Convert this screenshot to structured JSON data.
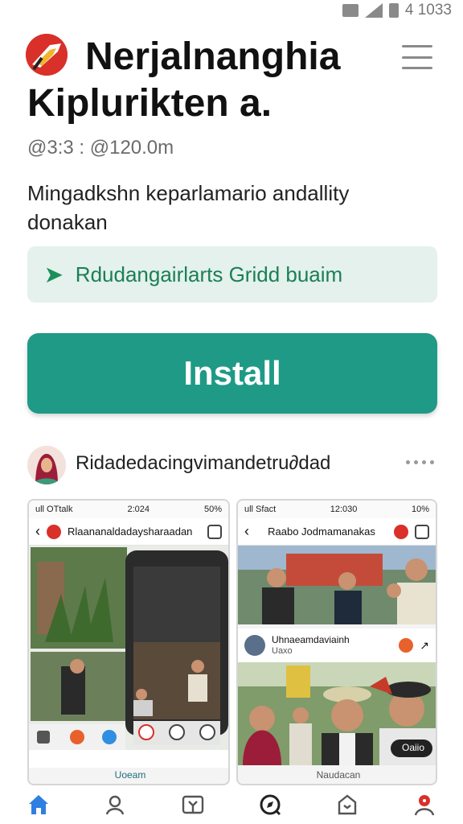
{
  "status_bar": {
    "time": "4 1033"
  },
  "app": {
    "title": "Nerjalnanghia Kiplurikten a.",
    "meta": "@3:3 : @120.0m",
    "description": "Mingadkshn keparlamario andallity donakan",
    "feature_text": "Rdudangairlarts Gridd buaim",
    "install_label": "Install"
  },
  "developer": {
    "name": "Ridadedacingvimandetru∂dad"
  },
  "screenshots": [
    {
      "status_left": "ull OTtalk",
      "status_time": "2:024",
      "status_right": "50%",
      "title": "Rlaananaldadaysharaadan",
      "footer": "Uoeam"
    },
    {
      "status_left": "ull Sfact",
      "status_time": "12:030",
      "status_right": "10%",
      "title": "Raabo Jodmamanakas",
      "post_title": "Uhnaeamdaviainh",
      "post_sub": "Uaxo",
      "badge": "Oaiio",
      "footer": "Naudacan"
    }
  ],
  "colors": {
    "accent": "#1e9a86",
    "banner_bg": "#e4f1ec",
    "banner_text": "#1b7f56",
    "nav_active": "#2f7fe0",
    "logo_red": "#d9302a"
  },
  "icons": [
    "menu-icon",
    "more-dots-icon",
    "home-icon",
    "search-person-icon",
    "gift-icon",
    "compass-icon",
    "bag-icon",
    "profile-icon"
  ]
}
